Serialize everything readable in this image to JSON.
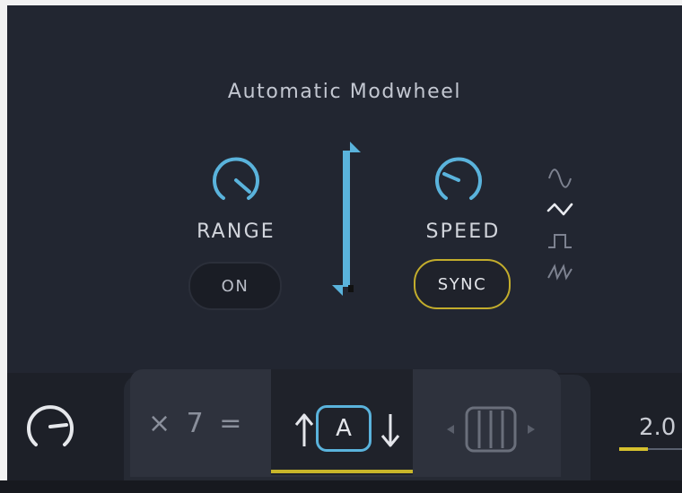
{
  "title": "Automatic Modwheel",
  "range": {
    "label": "RANGE",
    "button_label": "ON"
  },
  "speed": {
    "label": "SPEED",
    "button_label": "SYNC"
  },
  "waveforms": [
    "sine",
    "triangle",
    "square",
    "sawtooth"
  ],
  "arp": {
    "multiplier_text": "× 7 =",
    "mode_label": "A"
  },
  "value_display": "2.0",
  "colors": {
    "panel": "#222631",
    "accent_blue": "#5ab3dc",
    "accent_yellow": "#c3ad2c",
    "text": "#d2d5dc"
  }
}
